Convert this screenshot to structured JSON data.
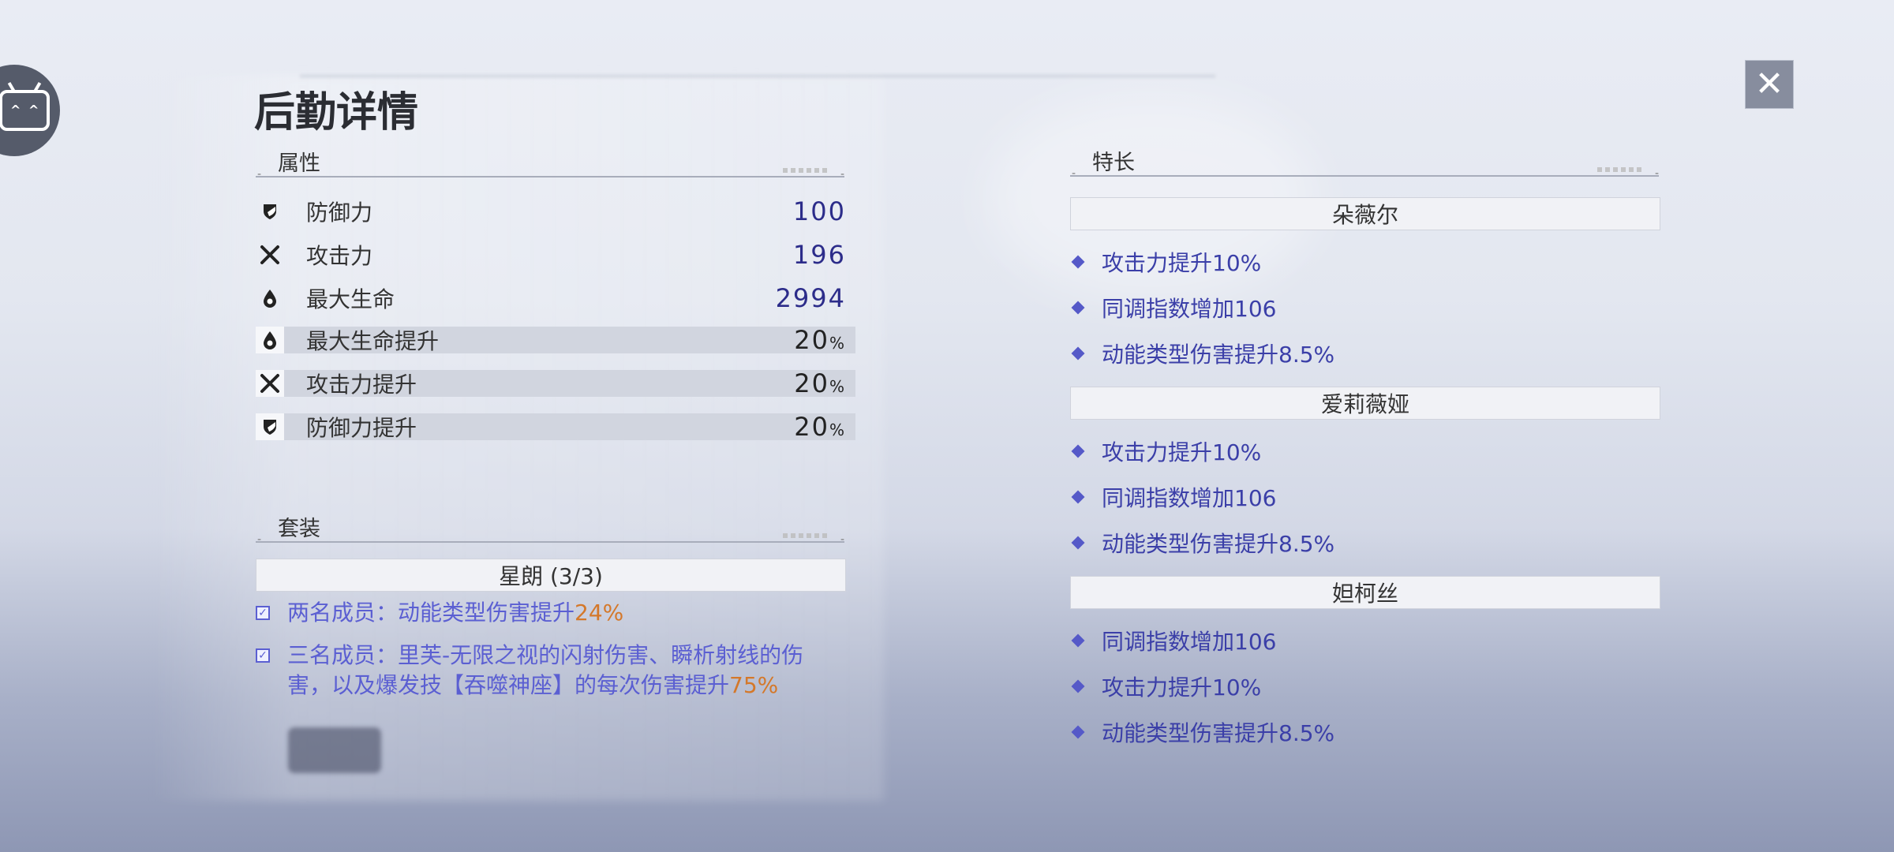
{
  "title": "后勤详情",
  "close_label": "✕",
  "attributes": {
    "heading": "属性",
    "rows": [
      {
        "name": "防御力",
        "value": "100",
        "unit": "",
        "icon": "shield-icon",
        "shaded": false
      },
      {
        "name": "攻击力",
        "value": "196",
        "unit": "",
        "icon": "swords-icon",
        "shaded": false
      },
      {
        "name": "最大生命",
        "value": "2994",
        "unit": "",
        "icon": "drop-icon",
        "shaded": false
      },
      {
        "name": "最大生命提升",
        "value": "20",
        "unit": "%",
        "icon": "drop-icon",
        "shaded": true
      },
      {
        "name": "攻击力提升",
        "value": "20",
        "unit": "%",
        "icon": "swords-icon",
        "shaded": true
      },
      {
        "name": "防御力提升",
        "value": "20",
        "unit": "%",
        "icon": "shield-icon",
        "shaded": true
      }
    ]
  },
  "set": {
    "heading": "套装",
    "name": "星朗 (3/3)",
    "bonuses": [
      {
        "text": "两名成员：动能类型伤害提升",
        "pct": "24%",
        "checked": true
      },
      {
        "text": "三名成员：里芙-无限之视的闪射伤害、瞬析射线的伤害，以及爆发技【吞噬神座】的每次伤害提升",
        "pct": "75%",
        "checked": true
      }
    ]
  },
  "specialties": {
    "heading": "特长",
    "groups": [
      {
        "name": "朵薇尔",
        "items": [
          "攻击力提升10%",
          "同调指数增加106",
          "动能类型伤害提升8.5%"
        ]
      },
      {
        "name": "爱莉薇娅",
        "items": [
          "攻击力提升10%",
          "同调指数增加106",
          "动能类型伤害提升8.5%"
        ]
      },
      {
        "name": "妲柯丝",
        "items": [
          "同调指数增加106",
          "攻击力提升10%",
          "动能类型伤害提升8.5%"
        ]
      }
    ]
  },
  "colors": {
    "accent": "#5b5fd2",
    "highlight": "#d4782a",
    "value": "#2c2c8a"
  }
}
